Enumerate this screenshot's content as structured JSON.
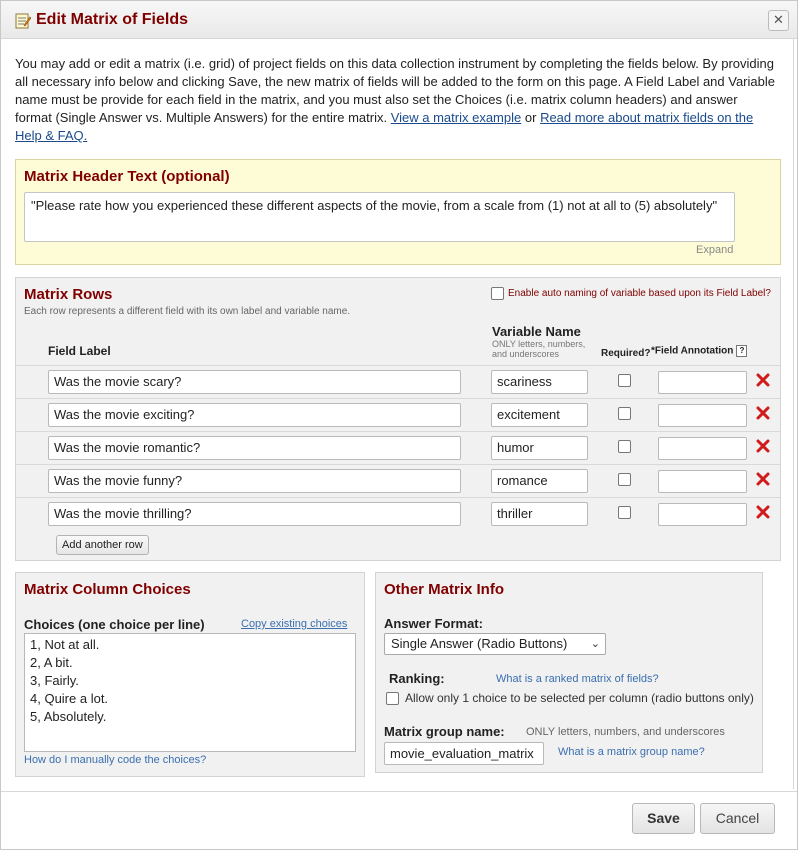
{
  "dialog": {
    "title": "Edit Matrix of Fields",
    "close_symbol": "✕"
  },
  "intro": {
    "text": "You may add or edit a matrix (i.e. grid) of project fields on this data collection instrument by completing the fields below. By providing all necessary info below and clicking Save, the new matrix of fields will be added to the form on this page. A Field Label and Variable name must be provide for each field in the matrix, and you must also set the Choices (i.e. matrix column headers) and answer format (Single Answer vs. Multiple Answers) for the entire matrix.",
    "link_example": "View a matrix example",
    "or": "or",
    "link_more": "Read more about matrix fields on the Help & FAQ."
  },
  "header_section": {
    "title": "Matrix Header Text (optional)",
    "value": "\"Please rate how you experienced these different aspects of the movie, from a scale from (1) not at all to (5) absolutely\"",
    "expand": "Expand"
  },
  "rows_section": {
    "title": "Matrix Rows",
    "subtitle": "Each row represents a different field with its own label and variable name.",
    "autoname_label": "Enable auto naming of variable based upon its Field Label?",
    "col_field_label": "Field Label",
    "col_variable_name": "Variable Name",
    "col_variable_note": "ONLY letters, numbers, and underscores",
    "col_required": "Required?",
    "col_annotation": "*Field Annotation",
    "help_symbol": "?",
    "rows": [
      {
        "label": "Was the movie scary?",
        "variable": "scariness"
      },
      {
        "label": "Was the movie exciting?",
        "variable": "excitement"
      },
      {
        "label": "Was the movie romantic?",
        "variable": "humor"
      },
      {
        "label": "Was the movie funny?",
        "variable": "romance"
      },
      {
        "label": "Was the movie thrilling?",
        "variable": "thriller"
      }
    ],
    "add_row": "Add another row"
  },
  "choices_section": {
    "title": "Matrix Column Choices",
    "label": "Choices (one choice per line)",
    "copy_link": "Copy existing choices",
    "choices": [
      "1, Not at all.",
      "2, A bit.",
      "3, Fairly.",
      "4, Quire a lot.",
      "5, Absolutely."
    ],
    "manual_link": "How do I manually code the choices?"
  },
  "other_section": {
    "title": "Other Matrix Info",
    "answer_format_label": "Answer Format:",
    "answer_format_value": "Single Answer (Radio Buttons)",
    "ranking_label": "Ranking:",
    "ranking_link": "What is a ranked matrix of fields?",
    "ranking_option": "Allow only 1 choice to be selected per column (radio buttons only)",
    "group_label": "Matrix group name:",
    "group_note": "ONLY letters, numbers, and underscores",
    "group_value": "movie_evaluation_matrix",
    "group_link": "What is a matrix group name?"
  },
  "footer": {
    "save": "Save",
    "cancel": "Cancel"
  },
  "colors": {
    "title": "#800000",
    "link": "#1a4a8c",
    "header_bg": "#fefcd6",
    "section_bg": "#f1f1f1",
    "delete": "#d11a1a"
  }
}
